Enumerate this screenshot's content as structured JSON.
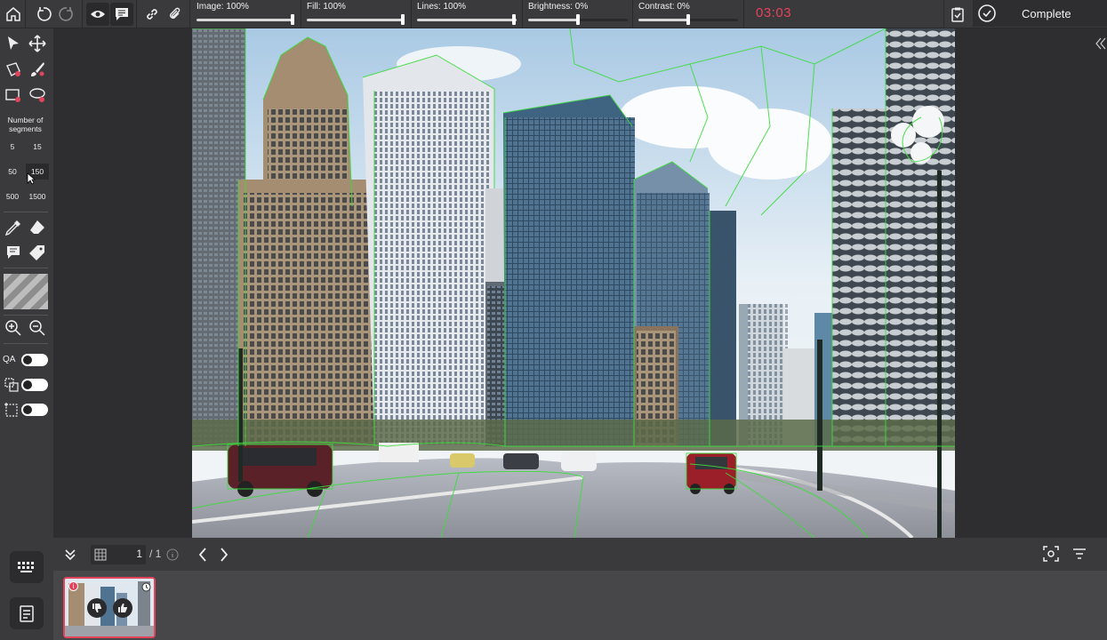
{
  "toolbar": {
    "sliders": {
      "image": "Image: 100%",
      "fill": "Fill: 100%",
      "lines": "Lines: 100%",
      "brightness": "Brightness: 0%",
      "contrast": "Contrast: 0%"
    },
    "slider_levels": {
      "image": 1.0,
      "fill": 1.0,
      "lines": 1.0,
      "brightness": 0.5,
      "contrast": 0.5
    },
    "timer": "03:03",
    "complete_label": "Complete"
  },
  "tools": {
    "segments_title": "Number of segments",
    "segment_options": [
      "5",
      "15",
      "50",
      "150",
      "500",
      "1500"
    ],
    "selected_segments": "150",
    "qa_label": "QA"
  },
  "pagination": {
    "current": "1",
    "total": "/ 1"
  },
  "icons": [
    "home-icon",
    "undo-icon",
    "redo-icon",
    "eye-icon",
    "comment-icon",
    "link-icon",
    "paperclip-icon",
    "clipboard-check-icon",
    "check-circle-icon",
    "collapse-icon",
    "pointer-icon",
    "move-icon",
    "polygon-icon",
    "brush-icon",
    "box-add-icon",
    "lasso-icon",
    "eyedropper-icon",
    "eraser-icon",
    "comment-tool-icon",
    "tag-icon",
    "zoom-in-icon",
    "zoom-out-icon",
    "chevrons-down-icon",
    "grid-icon",
    "info-icon",
    "chevron-left-icon",
    "chevron-right-icon",
    "focus-icon",
    "filter-icon",
    "keyboard-icon",
    "notes-icon",
    "thumbs-down-icon",
    "thumbs-up-icon",
    "clock-icon"
  ],
  "colors": {
    "accent": "#e4445b",
    "overlay": "#3ddc3d",
    "panel": "#3a3a3d"
  }
}
